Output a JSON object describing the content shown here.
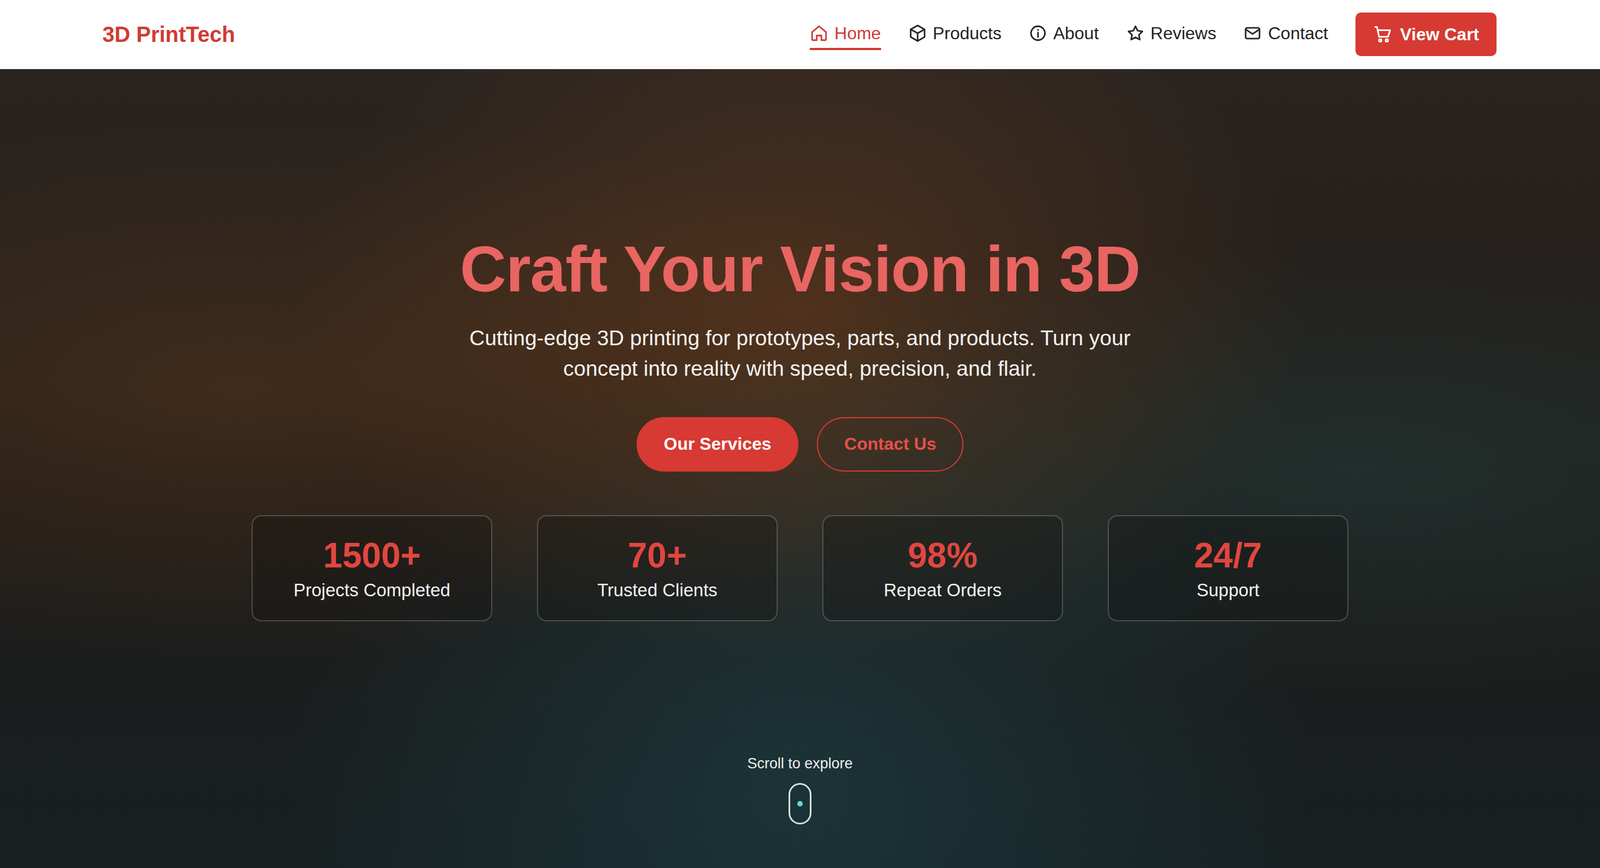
{
  "brand": "3D PrintTech",
  "nav": {
    "items": [
      {
        "label": "Home",
        "selected": true
      },
      {
        "label": "Products",
        "selected": false
      },
      {
        "label": "About",
        "selected": false
      },
      {
        "label": "Reviews",
        "selected": false
      },
      {
        "label": "Contact",
        "selected": false
      }
    ]
  },
  "cart": {
    "label": "View Cart"
  },
  "hero": {
    "title": "Craft Your Vision in 3D",
    "subtitle": "Cutting-edge 3D printing for prototypes, parts, and products. Turn your concept into reality with speed, precision, and flair.",
    "actions": [
      {
        "label": "Our Services",
        "kind": "primary"
      },
      {
        "label": "Contact Us",
        "kind": "outline"
      }
    ],
    "stats": [
      {
        "value": "1500+",
        "label": "Projects Completed"
      },
      {
        "value": "70+",
        "label": "Trusted Clients"
      },
      {
        "value": "98%",
        "label": "Repeat Orders"
      },
      {
        "value": "24/7",
        "label": "Support"
      }
    ],
    "scroll": {
      "label": "Scroll to explore"
    }
  }
}
